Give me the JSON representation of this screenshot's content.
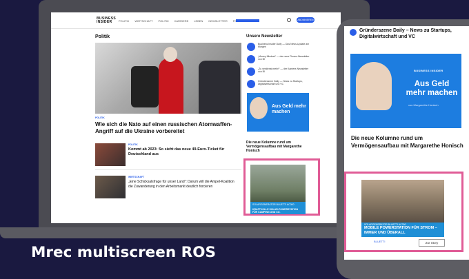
{
  "caption": "Mrec multiscreen ROS",
  "desktop": {
    "logo": "BUSINESS INSIDER",
    "nav": [
      "POLITIK",
      "WIRTSCHAFT",
      "POLITIK",
      "KARRIERE",
      "LEBEN",
      "NEWSLETTER",
      "PODCAST"
    ],
    "subscribe_label": "ABONNIEREN",
    "section_title": "Politik",
    "hero_kicker": "POLITIK",
    "hero_headline": "Wie sich die Nato auf einen russischen Atomwaffen-Angriff auf die Ukraine vorbereitet",
    "articles": [
      {
        "kicker": "POLITIK",
        "title": "Kommt ab 2023: So sieht das neue 49-Euro-Ticket für Deutschland aus"
      },
      {
        "kicker": "WIRTSCHAFT",
        "title": "„Eine Schicksalsfrage für unser Land“: Darum will die Ampel-Koalition die Zuwanderung in den Arbeitsmarkt deutlich forcieren"
      }
    ],
    "newsletter_title": "Unsere Newsletter",
    "newsletters": [
      "Business Insider Daily — Das News-Update am Morgen",
      "„Money Mindset“ — der neue Finanz-Newsletter von BI",
      "„Zu verdienst mehr!“ — der Karriere-Newsletter von BI",
      "Gründerszene Daily — News zu Startups, Digitalwirtschaft und VC"
    ],
    "promo_title": "Aus Geld mehr machen",
    "promo_caption": "Die neue Kolumne rund um Vermögensaufbau mit Margarethe Honisch",
    "ad_label": "SOLARGENERATOR BLUETTI AC300",
    "ad_headline": "KRAFTVOLLE SOLAR-POWERSTATION FÜR CAMPING UND CO."
  },
  "mobile": {
    "top_text": "Gründerszene Daily – News zu Startups, Digitalwirtschaft und VC",
    "promo_label": "BUSINESS INSIDER",
    "promo_title": "Aus Geld mehr machen",
    "promo_author": "von Margarethe Honisch",
    "caption": "Die neue Kolumne rund um Vermögensaufbau mit Margarethe Honisch",
    "ad_label": "SOLARGENERATOR BLUETTI AC300",
    "ad_headline": "MOBILE POWERSTATION FÜR STROM – IMMER UND ÜBERALL",
    "ad_logo": "BLUETTI",
    "ad_button": "Zur Story"
  }
}
